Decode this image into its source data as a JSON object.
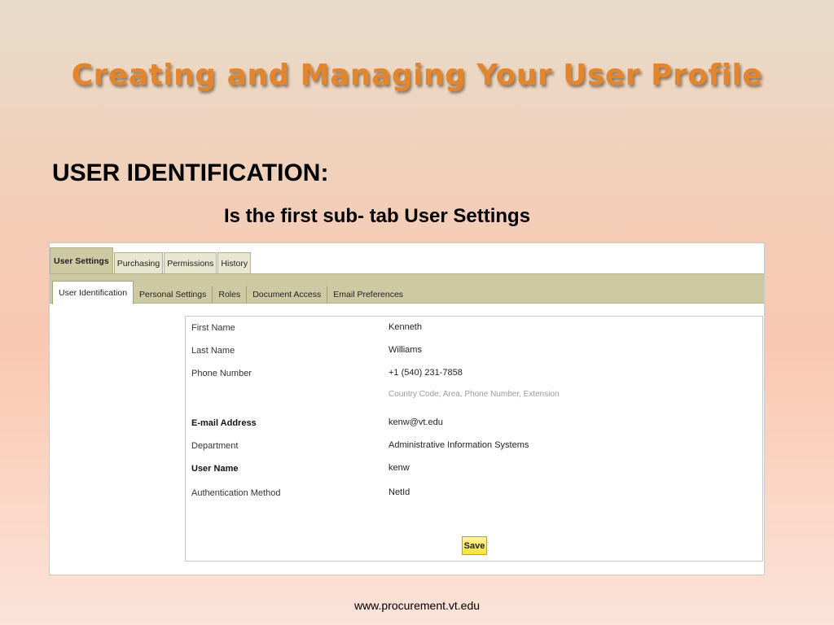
{
  "slide": {
    "title": "Creating and Managing Your User Profile",
    "heading": "USER IDENTIFICATION:",
    "subheading": "Is the first sub- tab User Settings",
    "footer": "www.procurement.vt.edu"
  },
  "tabs": {
    "main": [
      "User Settings",
      "Purchasing",
      "Permissions",
      "History"
    ],
    "sub": [
      "User Identification",
      "Personal Settings",
      "Roles",
      "Document Access",
      "Email Preferences"
    ]
  },
  "form": {
    "first_name_label": "First Name",
    "first_name_value": "Kenneth",
    "last_name_label": "Last Name",
    "last_name_value": "Williams",
    "phone_label": "Phone Number",
    "phone_value": "+1 (540) 231-7858",
    "phone_hint": "Country Code, Area, Phone Number, Extension",
    "email_label": "E-mail Address",
    "email_value": "kenw@vt.edu",
    "department_label": "Department",
    "department_value": "Administrative Information Systems",
    "username_label": "User Name",
    "username_value": "kenw",
    "auth_label": "Authentication Method",
    "auth_value": "NetId",
    "save_label": "Save"
  },
  "colors": {
    "title": "#e2852c",
    "tab_bar": "#cdcaa3",
    "save_button": "#f8e43a"
  }
}
